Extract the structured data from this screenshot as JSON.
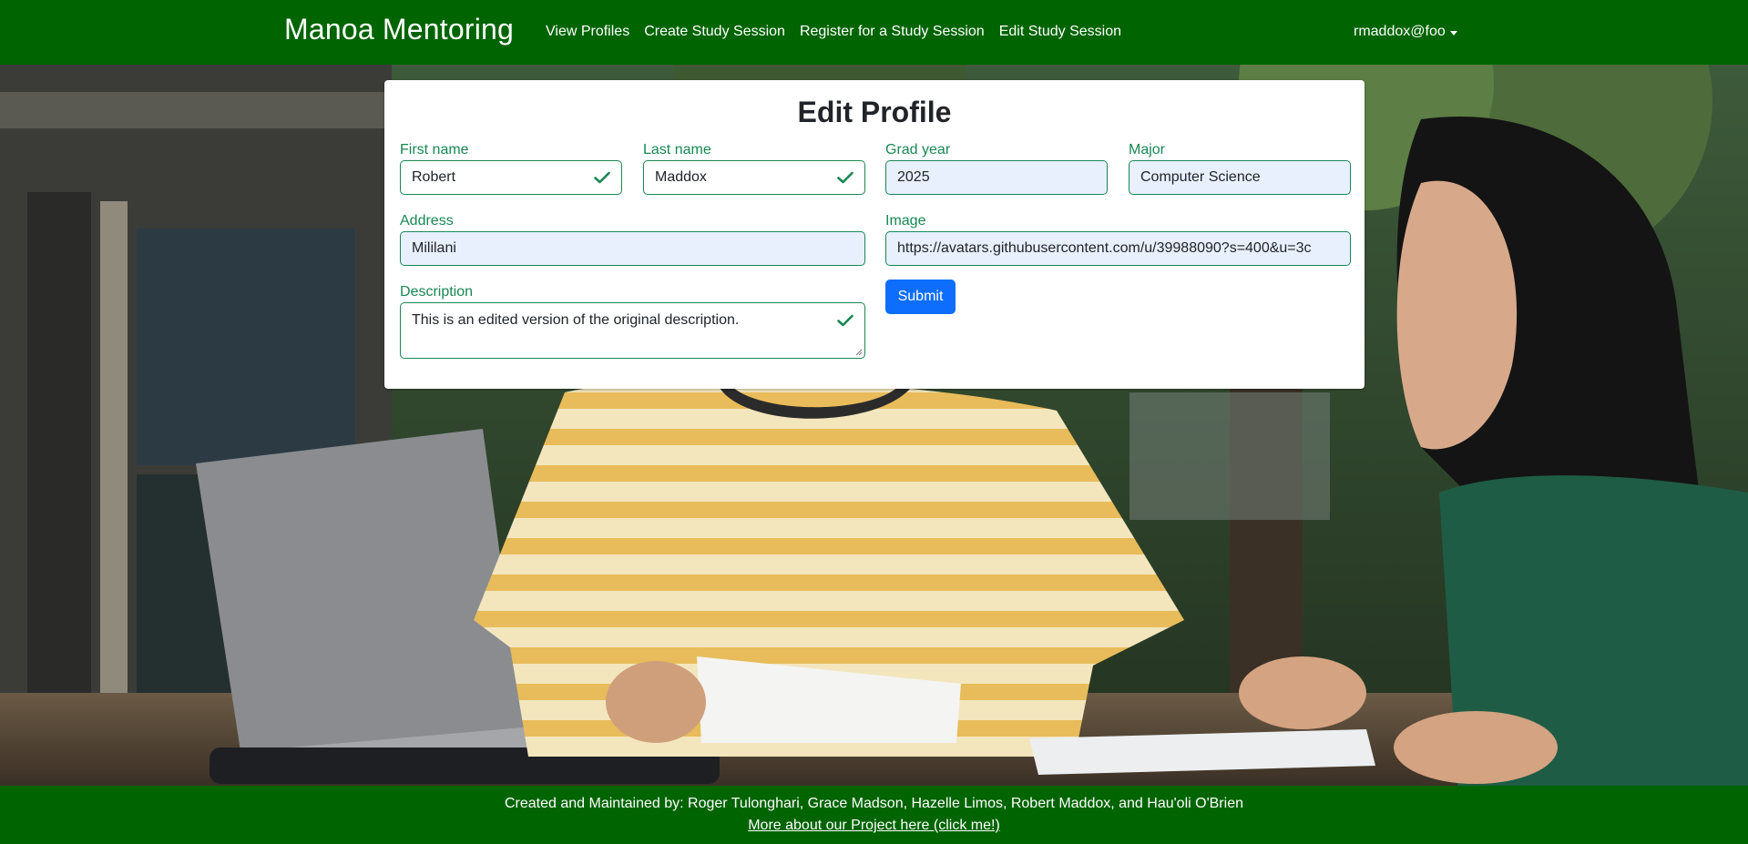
{
  "navbar": {
    "brand": "Manoa Mentoring",
    "links": [
      "View Profiles",
      "Create Study Session",
      "Register for a Study Session",
      "Edit Study Session"
    ],
    "user": "rmaddox@foo"
  },
  "form": {
    "title": "Edit Profile",
    "first_name": {
      "label": "First name",
      "value": "Robert"
    },
    "last_name": {
      "label": "Last name",
      "value": "Maddox"
    },
    "grad_year": {
      "label": "Grad year",
      "value": "2025"
    },
    "major": {
      "label": "Major",
      "value": "Computer Science"
    },
    "address": {
      "label": "Address",
      "value": "Mililani"
    },
    "image": {
      "label": "Image",
      "value": "https://avatars.githubusercontent.com/u/39988090?s=400&u=3c"
    },
    "description": {
      "label": "Description",
      "value": "This is an edited version of the original description."
    },
    "submit_label": "Submit"
  },
  "footer": {
    "credits": "Created and Maintained by: Roger Tulonghari, Grace Madson, Hazelle Limos, Robert Maddox, and Hau'oli O'Brien",
    "link": "More about our Project here (click me!)"
  },
  "colors": {
    "nav_green": "#006400",
    "valid_green": "#198754",
    "submit_blue": "#0d6efd",
    "autofill_bg": "#e8f0fe"
  }
}
